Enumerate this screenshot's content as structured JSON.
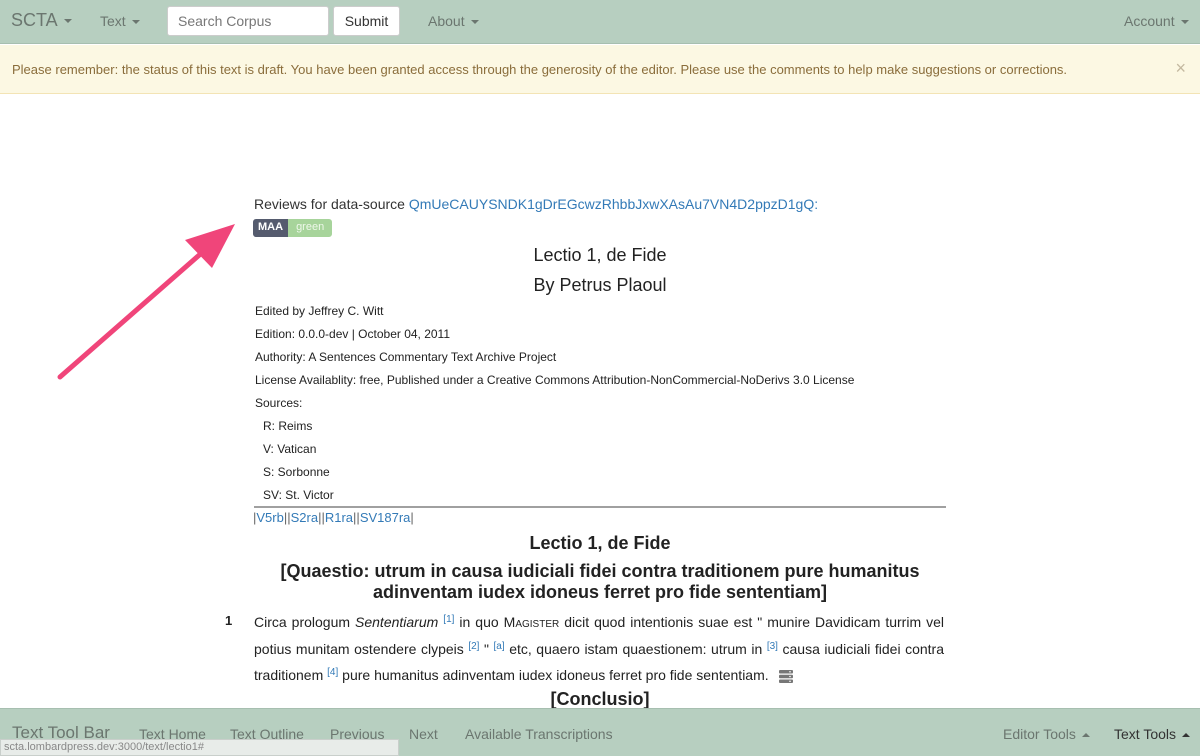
{
  "navbar": {
    "brand": "SCTA",
    "text_menu": "Text",
    "search_placeholder": "Search Corpus",
    "submit_label": "Submit",
    "about_menu": "About",
    "account_menu": "Account"
  },
  "alert": {
    "message": "Please remember: the status of this text is draft. You have been granted access through the generosity of the editor. Please use the comments to help make suggestions or corrections.",
    "close": "×"
  },
  "reviews": {
    "prefix": "Reviews for data-source",
    "link": "QmUeCAUYSNDK1gDrEGcwzRhbbJxwXAsAu7VN4D2ppzD1gQ:",
    "badge_left": "MAA",
    "badge_right": "green"
  },
  "header": {
    "title": "Lectio 1, de Fide",
    "author": "By Petrus Plaoul",
    "edited_by": "Edited by Jeffrey C. Witt",
    "edition": "Edition: 0.0.0-dev | October 04, 2011",
    "authority": "Authority: A Sentences Commentary Text Archive Project",
    "license": "License Availablity: free, Published under a Creative Commons Attribution-NonCommercial-NoDerivs 3.0 License",
    "sources_label": "Sources:",
    "sources": [
      "R: Reims",
      "V: Vatican",
      "S: Sorbonne",
      "SV: St. Victor"
    ]
  },
  "folios": [
    "V5rb",
    "S2ra",
    "R1ra",
    "SV187ra"
  ],
  "body": {
    "section_title": "Lectio 1, de Fide",
    "question": "[Quaestio: utrum in causa iudiciali fidei contra traditionem pure humanitus adinventam iudex idoneus ferret pro fide sententiam]",
    "para_number": "1",
    "para": {
      "t1": "Circa prologum ",
      "t2": "Sententiarum",
      "fn1": "[1]",
      "t3": " in quo ",
      "t4": "Magister",
      "t5": " dicit quod intentionis suae est \" munire Davidicam turrim vel potius munitam ostendere clypeis ",
      "fn2": "[2]",
      "t6": " \" ",
      "fn3": "[a]",
      "t7": " etc, quaero istam quaestionem: utrum in ",
      "fn4": "[3]",
      "t8": " causa iudiciali fidei contra traditionem ",
      "fn5": "[4]",
      "t9": " pure humanitus adinventam iudex idoneus ferret pro fide sententiam."
    },
    "next_heading": "[Conclusio]"
  },
  "toolbar": {
    "brand": "Text Tool Bar",
    "home": "Text Home",
    "outline": "Text Outline",
    "previous": "Previous",
    "next": "Next",
    "transcriptions": "Available Transcriptions",
    "editor_tools": "Editor Tools",
    "text_tools": "Text Tools"
  },
  "status_url": "scta.lombardpress.dev:3000/text/lectio1#",
  "colors": {
    "navbar": "#b7cfc0",
    "alert_bg": "#fcf8e3",
    "alert_text": "#8a6d3b",
    "link": "#337ab7",
    "arrow": "#f0457a"
  }
}
